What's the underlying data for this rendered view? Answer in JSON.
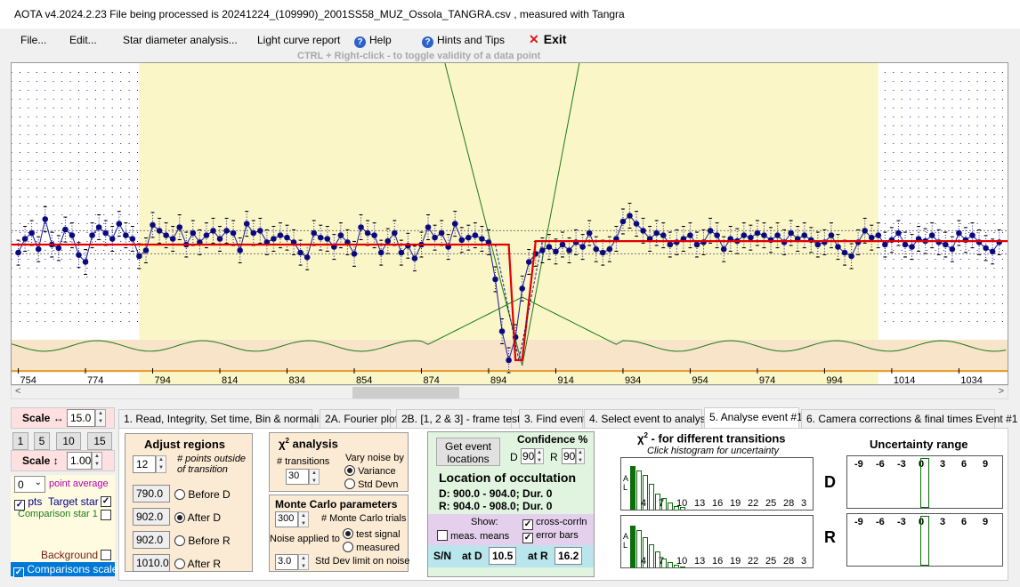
{
  "titlebar": {
    "text": "AOTA v4.2024.2.23    File being processed is  20241224_(109990)_2001SS58_MUZ_Ossola_TANGRA.csv ,  measured with Tangra"
  },
  "menu": {
    "file": "File...",
    "edit": "Edit...",
    "star_diameter": "Star diameter analysis...",
    "light_curve": "Light curve report",
    "help": "Help",
    "hints": "Hints and Tips",
    "exit": "Exit",
    "hint_text": "CTRL + Right-click   -   to toggle validity of a data point"
  },
  "plot": {
    "x_ticks": [
      "754",
      "774",
      "794",
      "814",
      "834",
      "854",
      "874",
      "894",
      "914",
      "934",
      "954",
      "974",
      "994",
      "1014",
      "1034"
    ],
    "x_tick_values": [
      754,
      774,
      794,
      814,
      834,
      854,
      874,
      894,
      914,
      934,
      954,
      974,
      994,
      1014,
      1034
    ],
    "x_range": [
      752,
      1049
    ],
    "highlight_region": [
      790,
      1010
    ],
    "colors": {
      "highlight": "#faf6c8",
      "noise_band": "#f8e4c8",
      "model": "#e00000",
      "data": "#0a0a80",
      "chi2": "#1a7a1a"
    }
  },
  "chart_data": {
    "type": "scatter",
    "title": "",
    "xlabel": "",
    "ylabel": "",
    "xlim": [
      752,
      1049
    ],
    "series": [
      {
        "x": [
          754,
          756,
          758,
          760,
          762,
          764,
          766,
          768,
          770,
          772,
          774,
          776,
          778,
          780,
          782,
          784,
          786,
          788,
          790,
          792,
          794,
          796,
          798,
          800,
          802,
          804,
          806,
          808,
          810,
          812,
          814,
          816,
          818,
          820,
          822,
          824,
          826,
          828,
          830,
          832,
          834,
          836,
          838,
          840,
          842,
          844,
          846,
          848,
          850,
          852,
          854,
          856,
          858,
          860,
          862,
          864,
          866,
          868,
          870,
          872,
          874,
          876,
          878,
          880,
          882,
          884,
          886,
          888,
          890,
          892,
          894,
          896,
          898,
          900,
          902,
          904,
          906,
          908,
          910,
          912,
          914,
          916,
          918,
          920,
          922,
          924,
          926,
          928,
          930,
          932,
          934,
          936,
          938,
          940,
          942,
          944,
          946,
          948,
          950,
          952,
          954,
          956,
          958,
          960,
          962,
          964,
          966,
          968,
          970,
          972,
          974,
          976,
          978,
          980,
          982,
          984,
          986,
          988,
          990,
          992,
          994,
          996,
          998,
          1000,
          1002,
          1004,
          1006,
          1008,
          1010,
          1012,
          1014,
          1016,
          1018,
          1020,
          1022,
          1024,
          1026,
          1028,
          1030,
          1032,
          1034,
          1036,
          1038,
          1040,
          1042,
          1044,
          1046
        ],
        "y": [
          0.93,
          1.05,
          1.1,
          0.96,
          1.22,
          1.0,
          0.97,
          1.13,
          1.08,
          0.91,
          0.85,
          1.08,
          1.15,
          1.1,
          1.05,
          1.18,
          1.08,
          1.05,
          0.9,
          0.95,
          1.17,
          1.12,
          1.08,
          1.05,
          1.15,
          1.0,
          1.1,
          1.02,
          1.08,
          1.12,
          1.05,
          1.12,
          1.1,
          0.95,
          1.18,
          1.1,
          1.12,
          1.02,
          1.05,
          1.08,
          1.06,
          1.02,
          0.93,
          0.89,
          1.1,
          1.06,
          1.05,
          0.98,
          1.08,
          1.02,
          0.92,
          1.15,
          1.1,
          1.08,
          0.93,
          1.03,
          1.1,
          0.93,
          0.99,
          0.88,
          1.0,
          1.15,
          1.06,
          1.1,
          0.98,
          1.18,
          1.04,
          1.06,
          1.08,
          1.05,
          1.02,
          0.7,
          0.25,
          0.0,
          0.2,
          0.62,
          0.85,
          0.92,
          0.95,
          0.98,
          0.94,
          1.0,
          0.95,
          1.02,
          0.98,
          1.1,
          0.96,
          0.93,
          0.96,
          1.05,
          1.2,
          1.25,
          1.18,
          1.12,
          1.05,
          1.1,
          1.08,
          1.0,
          1.02,
          1.05,
          1.08,
          1.0,
          1.02,
          1.12,
          1.08,
          0.96,
          1.05,
          1.03,
          1.08,
          1.06,
          1.1,
          1.08,
          1.04,
          1.08,
          1.02,
          1.1,
          1.05,
          1.08,
          1.04,
          1.0,
          1.02,
          1.08,
          0.98,
          0.93,
          0.9,
          1.02,
          1.12,
          1.06,
          1.08,
          1.0,
          1.04,
          1.1,
          1.0,
          0.98,
          1.05,
          1.03,
          1.08,
          1.02,
          1.0,
          0.96,
          1.1,
          1.04,
          1.08,
          1.02,
          0.97,
          0.94,
          1.02
        ]
      }
    ]
  },
  "left": {
    "scale_h_label": "Scale ↔",
    "scale_h_value": "15.0",
    "preset_1": "1",
    "preset_5": "5",
    "preset_10": "10",
    "preset_15": "15",
    "scale_v_label": "Scale ↕",
    "scale_v_value": "1.00",
    "avg_value": "0",
    "avg_label": "point average",
    "pts_label": "pts",
    "target_label": "Target star",
    "comparison_label": "Comparison star 1",
    "background_label": "Background",
    "comparisons_scaled_label": "Comparisons scaled"
  },
  "tabs": [
    "1.  Read, Integrity, Set time, Bin & normalise",
    "2A. Fourier plot",
    "2B. [1, 2 & 3] - frame test",
    "3. Find events",
    "4. Select event to analyse",
    "5. Analyse event #1",
    "6. Camera corrections & final times Event #1"
  ],
  "adjust": {
    "title": "Adjust regions",
    "points_value": "12",
    "points_note_1": "# points outside",
    "points_note_2": "of transition",
    "before_d_value": "790.0",
    "before_d_label": "Before D",
    "after_d_value": "902.0",
    "after_d_label": "After D",
    "before_r_value": "902.0",
    "before_r_label": "Before R",
    "after_r_value": "1010.0",
    "after_r_label": "After R"
  },
  "chi2": {
    "title": " analysis",
    "transitions_label": "# transitions",
    "transitions_value": "30",
    "vary_label_1": "Vary noise by",
    "variance_label": "Variance",
    "stddevn_label": "Std Devn"
  },
  "monte": {
    "title": "Monte Carlo parameters",
    "trials_value": "300",
    "trials_label": "# Monte Carlo trials",
    "noise_label": "Noise applied to",
    "test_label": "test signal",
    "measured_label": "measured",
    "limit_value": "3.0",
    "limit_label": "Std Dev limit on noise"
  },
  "event": {
    "get_button": "Get event locations",
    "confidence_label": "Confidence  %",
    "conf_d_label": "D",
    "conf_d_value": "90",
    "conf_r_label": "R",
    "conf_r_value": "90",
    "location_title": "Location of occultation",
    "d_line": "D: 900.0 - 904.0; Dur. 0",
    "r_line": "R: 904.0 - 908.0; Dur. 0",
    "show_label": "Show:",
    "crosscorr_label": "cross-corrln",
    "meas_label": "meas. means",
    "errorbars_label": "error bars",
    "sn_label": "S/N",
    "at_d_label": "at D",
    "at_d_value": "10.5",
    "at_r_label": "at R",
    "at_r_value": "16.2"
  },
  "hist": {
    "title": " - for different transitions",
    "subtitle": "Click histogram for uncertainty",
    "ticks": [
      "4",
      "7",
      "10",
      "13",
      "16",
      "19",
      "22",
      "25",
      "28",
      "3"
    ],
    "d_label": "D",
    "r_label": "R",
    "bars_d": [
      0.95,
      0.85,
      0.75,
      0.55,
      0.35,
      0.25,
      0.15,
      0.08,
      0.05
    ],
    "bars_r": [
      0.9,
      0.8,
      0.65,
      0.5,
      0.35,
      0.2,
      0.12,
      0.05,
      0.02
    ]
  },
  "uncert": {
    "title": "Uncertainty range",
    "ticks": [
      "-9",
      "-6",
      "-3",
      "0",
      "3",
      "6",
      "9"
    ]
  }
}
